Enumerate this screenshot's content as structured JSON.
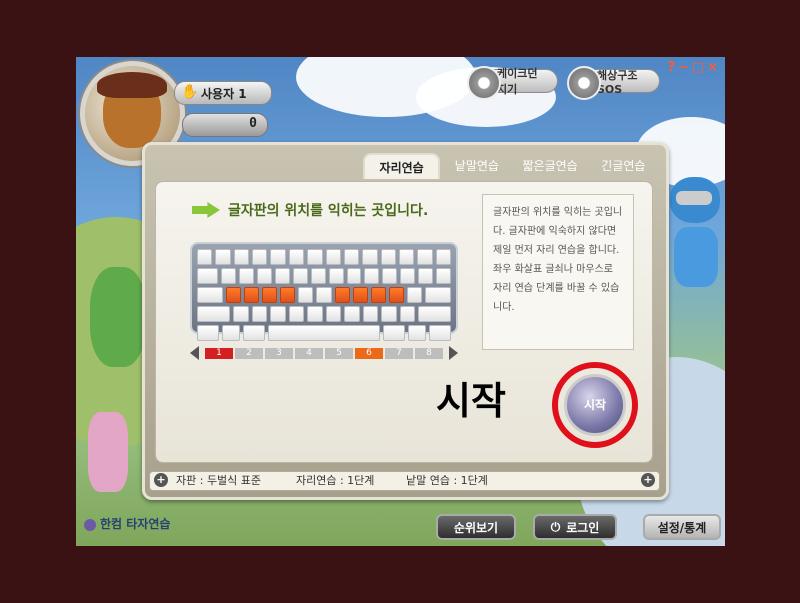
{
  "window": {
    "controls": "?−□×"
  },
  "top_buttons": {
    "cake": "케이크던지기",
    "sos": "해상구조SOS"
  },
  "user": {
    "name": "사용자 1",
    "score": "0"
  },
  "tabs": [
    {
      "label": "자리연습",
      "active": true
    },
    {
      "label": "낱말연습",
      "active": false
    },
    {
      "label": "짧은글연습",
      "active": false
    },
    {
      "label": "긴글연습",
      "active": false
    }
  ],
  "practice": {
    "heading": "글자판의 위치를 익히는 곳입니다.",
    "description": "글자판의 위치를 익히는 곳입니다. 글자판에 익숙하지 않다면 제일 먼저 자리 연습을 합니다. 좌우 화살표 글쇠나 마우스로 자리 연습 단계를 바꿀 수 있습니다.",
    "steps": [
      {
        "label": "1",
        "state": "current"
      },
      {
        "label": "2",
        "state": "normal"
      },
      {
        "label": "3",
        "state": "normal"
      },
      {
        "label": "4",
        "state": "normal"
      },
      {
        "label": "5",
        "state": "normal"
      },
      {
        "label": "6",
        "state": "highlight"
      },
      {
        "label": "7",
        "state": "normal"
      },
      {
        "label": "8",
        "state": "normal"
      }
    ],
    "start_annotation": "시작",
    "start_button": "시작"
  },
  "status": {
    "layout": "자판 : 두벌식 표준",
    "position_level": "자리연습 : 1단계",
    "word_level": "낱말 연습 : 1단계"
  },
  "bottom": {
    "logo": "한컴 타자연습",
    "ranking": "순위보기",
    "login": "로그인",
    "settings": "설정/통계"
  },
  "colors": {
    "accent_green": "#8ac63a",
    "highlight_key": "#e0501a",
    "annotation_ring": "#e0101a"
  }
}
